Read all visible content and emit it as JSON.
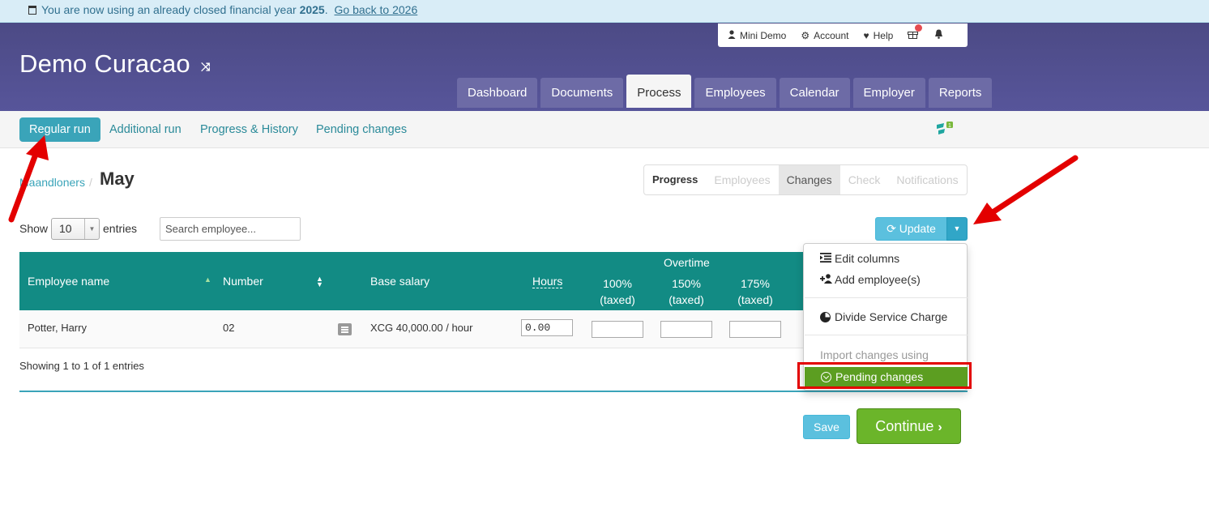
{
  "notice": {
    "prefix": "You are now using an already closed financial year",
    "year": "2025",
    "period": ".",
    "link": "Go back to 2026"
  },
  "brand": {
    "title": "Demo Curacao"
  },
  "topbar": {
    "user": "Mini Demo",
    "account": "Account",
    "help": "Help"
  },
  "main_tabs": [
    "Dashboard",
    "Documents",
    "Process",
    "Employees",
    "Calendar",
    "Employer",
    "Reports"
  ],
  "main_tab_active": "Process",
  "subnav": [
    "Regular run",
    "Additional run",
    "Progress & History",
    "Pending changes"
  ],
  "breadcrumb": {
    "parent": "Maandloners",
    "separator": "/",
    "current": "May"
  },
  "steps": [
    "Progress",
    "Employees",
    "Changes",
    "Check",
    "Notifications"
  ],
  "list": {
    "show": "Show",
    "entries_value": "10",
    "entries": "entries",
    "search_placeholder": "Search employee...",
    "info": "Showing 1 to 1 of 1 entries"
  },
  "update_button": "Update",
  "table": {
    "headers": {
      "employee_name": "Employee name",
      "number": "Number",
      "base_salary": "Base salary",
      "hours": "Hours",
      "overtime": "Overtime",
      "ot_100": "100%",
      "ot_150": "150%",
      "ot_175": "175%",
      "taxed": "(taxed)"
    },
    "rows": [
      {
        "name": "Potter, Harry",
        "number": "02",
        "base_salary": "XCG 40,000.00 / hour",
        "hours": "0.00"
      }
    ]
  },
  "dropdown": {
    "edit_columns": "Edit columns",
    "add_employees": "Add employee(s)",
    "divide_service_charge": "Divide Service Charge",
    "import_header": "Import changes using",
    "pending_changes": "Pending changes"
  },
  "buttons": {
    "save": "Save",
    "continue": "Continue"
  },
  "colors": {
    "header": "#4c4a85",
    "teal": "#128b84",
    "info": "#5bc0de",
    "success": "#6bb52a",
    "annotation": "#e30000"
  }
}
